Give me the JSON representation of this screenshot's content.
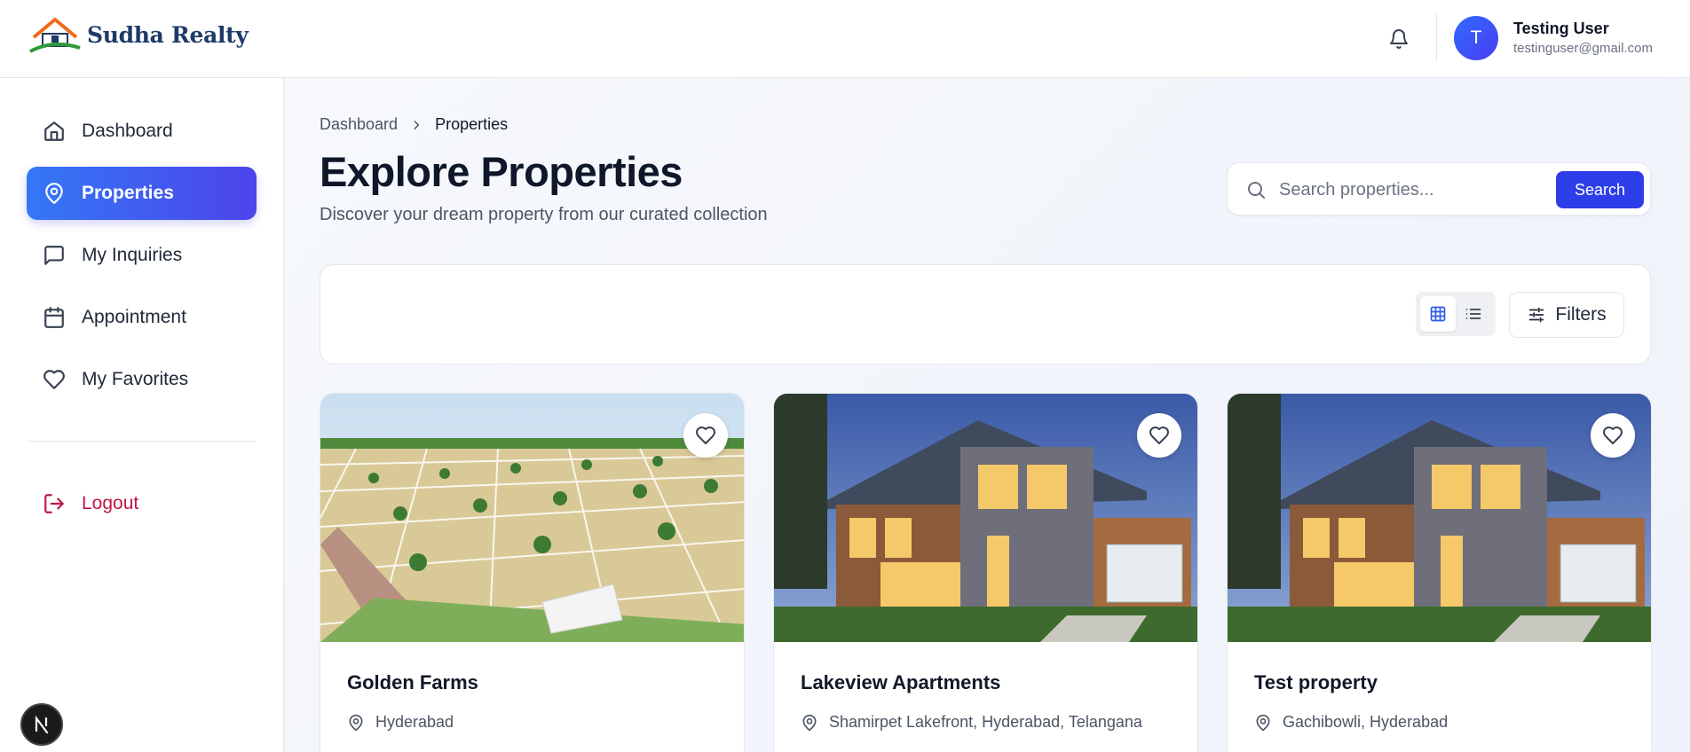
{
  "brand": {
    "name": "Sudha Realty",
    "logo_icon": "house-logo-icon"
  },
  "header": {
    "bell_icon": "bell-icon",
    "user": {
      "initial": "T",
      "name": "Testing User",
      "email": "testinguser@gmail.com"
    }
  },
  "sidebar": {
    "items": [
      {
        "label": "Dashboard",
        "icon": "home-icon"
      },
      {
        "label": "Properties",
        "icon": "map-pin-icon",
        "active": true
      },
      {
        "label": "My Inquiries",
        "icon": "message-square-icon"
      },
      {
        "label": "Appointment",
        "icon": "calendar-icon"
      },
      {
        "label": "My Favorites",
        "icon": "heart-icon"
      }
    ],
    "logout": {
      "label": "Logout",
      "icon": "logout-icon"
    },
    "dev_badge": "N"
  },
  "breadcrumb": {
    "root": "Dashboard",
    "current": "Properties"
  },
  "page": {
    "title": "Explore Properties",
    "subtitle": "Discover your dream property from our curated collection"
  },
  "search": {
    "placeholder": "Search properties...",
    "value": "",
    "button": "Search"
  },
  "toolbar": {
    "filters_label": "Filters",
    "view_mode": "grid"
  },
  "properties": [
    {
      "title": "Golden Farms",
      "location": "Hyderabad",
      "image": "farm-plots-image"
    },
    {
      "title": "Lakeview Apartments",
      "location": "Shamirpet Lakefront, Hyderabad, Telangana",
      "image": "modern-house-image"
    },
    {
      "title": "Test property",
      "location": "Gachibowli, Hyderabad",
      "image": "modern-house-image"
    }
  ],
  "colors": {
    "accent": "#3478f6",
    "accent2": "#4c44ea",
    "button": "#2d3ee8",
    "logout": "#c01846"
  }
}
